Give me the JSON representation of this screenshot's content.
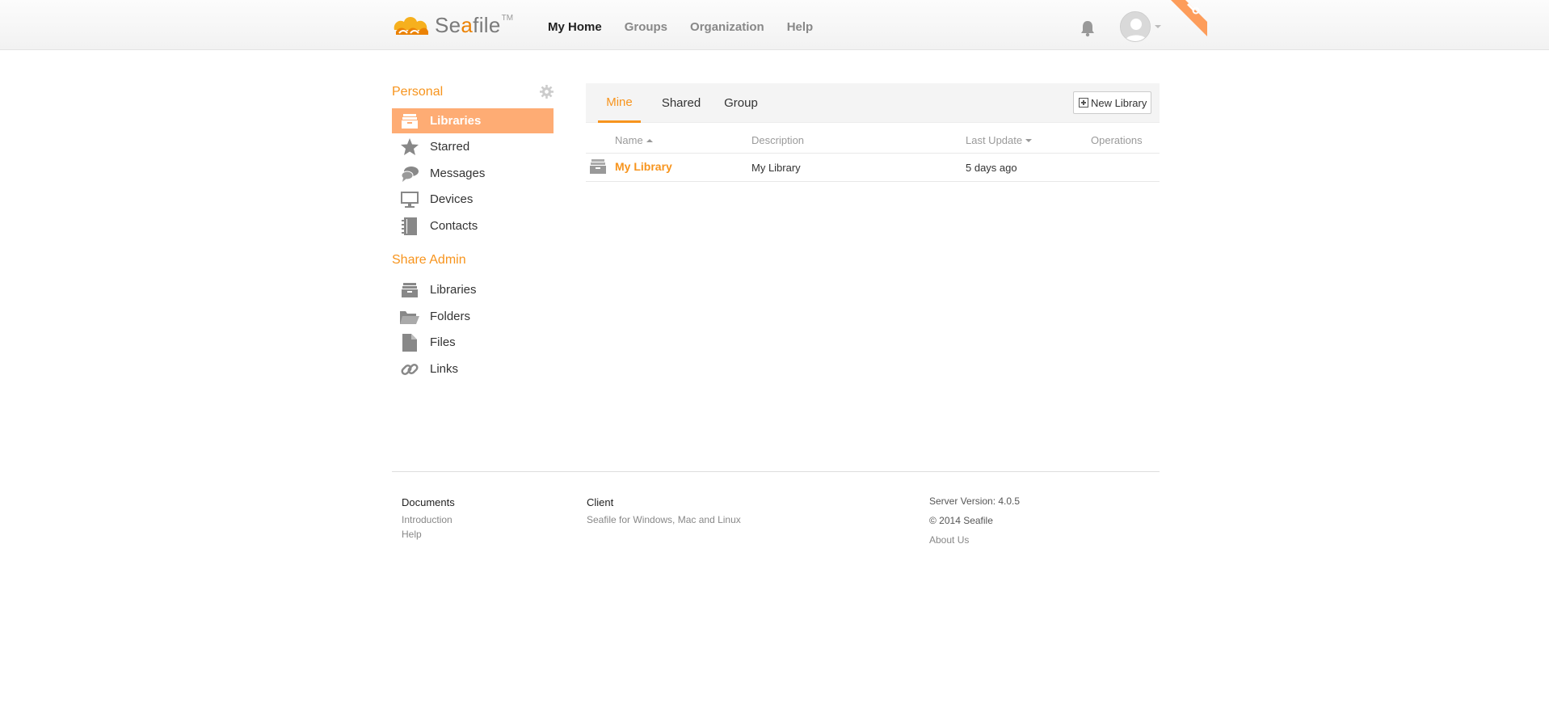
{
  "header": {
    "logo_text_a": "Se",
    "logo_text_b": "a",
    "logo_text_c": "file",
    "logo_tm": "TM",
    "nav": [
      "My Home",
      "Groups",
      "Organization",
      "Help"
    ],
    "active_nav": "My Home"
  },
  "sidebar": {
    "personal_title": "Personal",
    "personal_items": [
      {
        "label": "Libraries",
        "icon": "library-icon",
        "active": true
      },
      {
        "label": "Starred",
        "icon": "star-icon"
      },
      {
        "label": "Messages",
        "icon": "chat-icon"
      },
      {
        "label": "Devices",
        "icon": "monitor-icon"
      },
      {
        "label": "Contacts",
        "icon": "contacts-icon"
      }
    ],
    "share_title": "Share Admin",
    "share_items": [
      {
        "label": "Libraries",
        "icon": "library-icon"
      },
      {
        "label": "Folders",
        "icon": "folder-icon"
      },
      {
        "label": "Files",
        "icon": "file-icon"
      },
      {
        "label": "Links",
        "icon": "link-icon"
      }
    ]
  },
  "main": {
    "tabs": [
      "Mine",
      "Shared",
      "Group"
    ],
    "active_tab": "Mine",
    "new_library_label": "New Library",
    "columns": [
      "Name",
      "Description",
      "Last Update",
      "Operations"
    ],
    "rows": [
      {
        "name": "My Library",
        "description": "My Library",
        "last_update": "5 days ago"
      }
    ]
  },
  "footer": {
    "documents_title": "Documents",
    "documents_links": [
      "Introduction",
      "Help"
    ],
    "client_title": "Client",
    "client_link": "Seafile for Windows, Mac and Linux",
    "server_version": "Server Version: 4.0.5",
    "copyright": "© 2014 Seafile",
    "about": "About Us"
  },
  "colors": {
    "accent": "#f7941d",
    "active_sidebar_bg": "#feac74"
  }
}
